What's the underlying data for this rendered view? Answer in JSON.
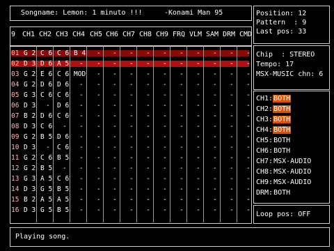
{
  "song": {
    "name_label": "Songname: Lemon: 1 minuto !!!",
    "author": "-Konami Man 95"
  },
  "info": {
    "position": "Position: 12",
    "pattern": "Pattern  : 9",
    "last_pos": "Last pos: 33"
  },
  "header": {
    "number": "9",
    "columns": [
      "CH1",
      "CH2",
      "CH3",
      "CH4",
      "CH5",
      "CH6",
      "CH7",
      "CH8",
      "CH9",
      "FRQ",
      "VLM",
      "SAM",
      "DRM",
      "CMD"
    ]
  },
  "rows": [
    {
      "n": "01",
      "c": [
        "G 2",
        "C 6",
        "C 6",
        "B 4",
        "-",
        "-",
        "-",
        "-",
        "-",
        "-",
        "-",
        "-",
        "-",
        "-"
      ]
    },
    {
      "n": "02",
      "c": [
        "D 3",
        "D 6",
        "A 5",
        "-",
        "-",
        "-",
        "-",
        "-",
        "-",
        "-",
        "-",
        "-",
        "-",
        "-"
      ]
    },
    {
      "n": "03",
      "c": [
        "G 2",
        "E 6",
        "C 6",
        "MOD",
        "-",
        "-",
        "-",
        "-",
        "-",
        "-",
        "-",
        "-",
        "-",
        "-"
      ]
    },
    {
      "n": "04",
      "c": [
        "G 2",
        "D 6",
        "D 6",
        "-",
        "-",
        "-",
        "-",
        "-",
        "-",
        "-",
        "-",
        "-",
        "-",
        "-"
      ]
    },
    {
      "n": "05",
      "c": [
        "G 3",
        "C 6",
        "C 6",
        "-",
        "-",
        "-",
        "-",
        "-",
        "-",
        "-",
        "-",
        "-",
        "-",
        "-"
      ]
    },
    {
      "n": "06",
      "c": [
        "D 3",
        "-",
        "D 6",
        "-",
        "-",
        "-",
        "-",
        "-",
        "-",
        "-",
        "-",
        "-",
        "-",
        "-"
      ]
    },
    {
      "n": "07",
      "c": [
        "B 2",
        "D 6",
        "C 6",
        "-",
        "-",
        "-",
        "-",
        "-",
        "-",
        "-",
        "-",
        "-",
        "-",
        "-"
      ]
    },
    {
      "n": "08",
      "c": [
        "D 3",
        "C 6",
        "-",
        "-",
        "-",
        "-",
        "-",
        "-",
        "-",
        "-",
        "-",
        "-",
        "-",
        "-"
      ]
    },
    {
      "n": "09",
      "c": [
        "G 2",
        "B 5",
        "D 6",
        "-",
        "-",
        "-",
        "-",
        "-",
        "-",
        "-",
        "-",
        "-",
        "-",
        "-"
      ]
    },
    {
      "n": "10",
      "c": [
        "D 3",
        "-",
        "C 6",
        "-",
        "-",
        "-",
        "-",
        "-",
        "-",
        "-",
        "-",
        "-",
        "-",
        "-"
      ]
    },
    {
      "n": "11",
      "c": [
        "G 2",
        "C 6",
        "B 5",
        "-",
        "-",
        "-",
        "-",
        "-",
        "-",
        "-",
        "-",
        "-",
        "-",
        "-"
      ]
    },
    {
      "n": "12",
      "c": [
        "G 2",
        "B 5",
        "-",
        "-",
        "-",
        "-",
        "-",
        "-",
        "-",
        "-",
        "-",
        "-",
        "-",
        "-"
      ]
    },
    {
      "n": "13",
      "c": [
        "G 3",
        "A 5",
        "C 6",
        "-",
        "-",
        "-",
        "-",
        "-",
        "-",
        "-",
        "-",
        "-",
        "-",
        "-"
      ]
    },
    {
      "n": "14",
      "c": [
        "D 3",
        "G 5",
        "B 5",
        "-",
        "-",
        "-",
        "-",
        "-",
        "-",
        "-",
        "-",
        "-",
        "-",
        "-"
      ]
    },
    {
      "n": "15",
      "c": [
        "B 2",
        "A 5",
        "A 5",
        "-",
        "-",
        "-",
        "-",
        "-",
        "-",
        "-",
        "-",
        "-",
        "-",
        "-"
      ]
    },
    {
      "n": "16",
      "c": [
        "D 3",
        "G 5",
        "B 5",
        "-",
        "-",
        "-",
        "-",
        "-",
        "-",
        "-",
        "-",
        "-",
        "-",
        "-"
      ]
    }
  ],
  "chip": {
    "chip": "Chip  : STEREO",
    "tempo": "Tempo: 17",
    "msx_music": "MSX-MUSIC chn: 6"
  },
  "channels": [
    {
      "label": "CH1:",
      "value": "BOTH",
      "highlight": true
    },
    {
      "label": "CH2:",
      "value": "BOTH",
      "highlight": true
    },
    {
      "label": "CH3:",
      "value": "BOTH",
      "highlight": true
    },
    {
      "label": "CH4:",
      "value": "BOTH",
      "highlight": true
    },
    {
      "label": "CH5:",
      "value": "BOTH",
      "highlight": false
    },
    {
      "label": "CH6:",
      "value": "BOTH",
      "highlight": false
    },
    {
      "label": "CH7:",
      "value": "MSX-AUDIO",
      "highlight": false
    },
    {
      "label": "CH8:",
      "value": "MSX-AUDIO",
      "highlight": false
    },
    {
      "label": "CH9:",
      "value": "MSX-AUDIO",
      "highlight": false
    },
    {
      "label": "DRM:",
      "value": "BOTH",
      "highlight": false
    }
  ],
  "loop": "Loop pos: OFF",
  "status": "Playing song.",
  "colors": {
    "row_current": "#b21010",
    "row_prev": "#8a0a0a",
    "channel_on": "#e05000"
  }
}
